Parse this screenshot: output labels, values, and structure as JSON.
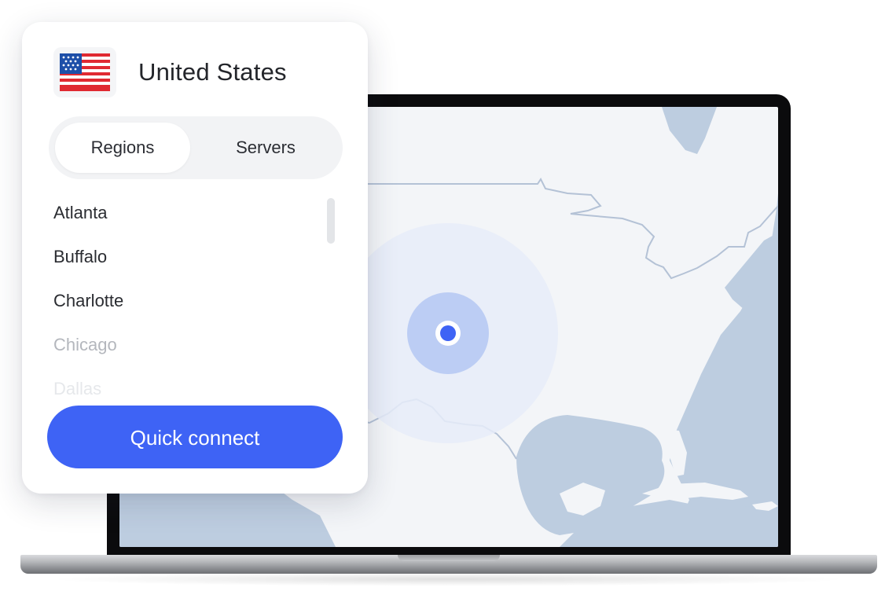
{
  "panel": {
    "country": "United States",
    "flag_icon": "us-flag-icon",
    "tabs": [
      {
        "label": "Regions",
        "active": true
      },
      {
        "label": "Servers",
        "active": false
      }
    ],
    "regions": [
      "Atlanta",
      "Buffalo",
      "Charlotte",
      "Chicago",
      "Dallas"
    ],
    "connect_label": "Quick connect"
  },
  "map": {
    "marker_icon": "location-pin-icon"
  },
  "colors": {
    "accent": "#3e63f5",
    "marker": "#3e63f5",
    "land": "#f3f5f8",
    "water": "#bdcde0",
    "border_lines": "#b4c2d6",
    "pulse_outer": "#e6ecf9",
    "pulse_inner": "#bccdf4"
  }
}
